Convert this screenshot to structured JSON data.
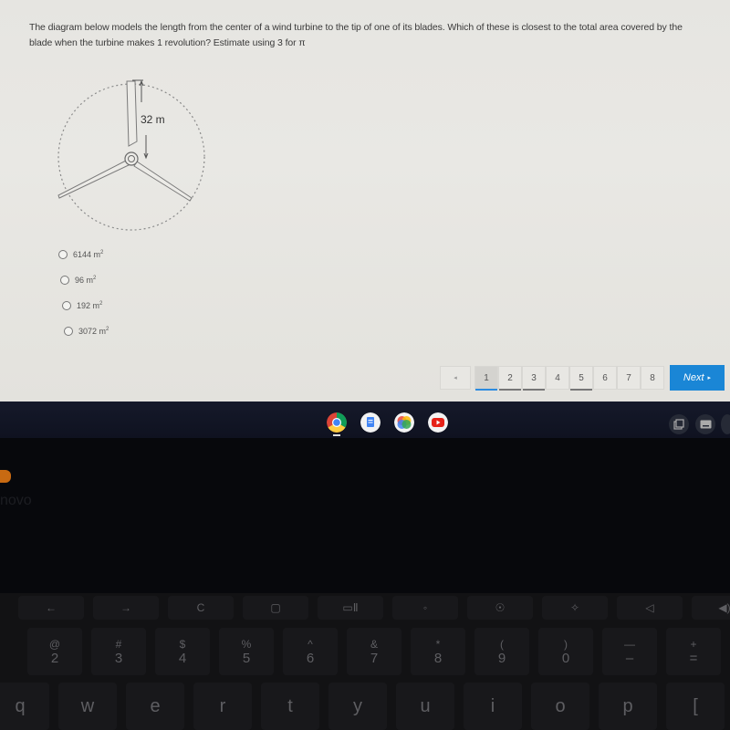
{
  "question": {
    "text": "The diagram below models the length from the center of a wind turbine to the tip of one of its blades.  Which of these is closest to the total area covered by the blade when the turbine makes 1 revolution?  Estimate using 3 for π"
  },
  "diagram": {
    "label": "32 m"
  },
  "choices": [
    {
      "value": "6144",
      "unit": "m",
      "exp": "2"
    },
    {
      "value": "96",
      "unit": "m",
      "exp": "2"
    },
    {
      "value": "192",
      "unit": "m",
      "exp": "2"
    },
    {
      "value": "3072",
      "unit": "m",
      "exp": "2"
    }
  ],
  "pager": {
    "prev_icon": "◂",
    "pages": [
      "1",
      "2",
      "3",
      "4",
      "5",
      "6",
      "7",
      "8"
    ],
    "current": "1",
    "answered": [
      "2",
      "3",
      "5"
    ],
    "next_label": "Next",
    "next_icon": "▸"
  },
  "shelf": {
    "apps": [
      {
        "name": "chrome",
        "active": true
      },
      {
        "name": "docs"
      },
      {
        "name": "photos"
      },
      {
        "name": "youtube"
      }
    ]
  },
  "laptop": {
    "brand": "novo"
  },
  "keyboard": {
    "function_row": [
      "←",
      "→",
      "C",
      "▢",
      "▭Ⅱ",
      "◦",
      "☉",
      "✧",
      "◁",
      "◀)"
    ],
    "number_row": [
      {
        "top": "@",
        "bot": "2"
      },
      {
        "top": "#",
        "bot": "3"
      },
      {
        "top": "$",
        "bot": "4"
      },
      {
        "top": "%",
        "bot": "5"
      },
      {
        "top": "^",
        "bot": "6"
      },
      {
        "top": "&",
        "bot": "7"
      },
      {
        "top": "*",
        "bot": "8"
      },
      {
        "top": "(",
        "bot": "9"
      },
      {
        "top": ")",
        "bot": "0"
      },
      {
        "top": "—",
        "bot": "–"
      },
      {
        "top": "+",
        "bot": "="
      }
    ],
    "letter_row": [
      "q",
      "w",
      "e",
      "r",
      "t",
      "y",
      "u",
      "i",
      "o",
      "p",
      "["
    ]
  },
  "colors": {
    "accent": "#1a86d6",
    "page_bg": "#e6e5e1",
    "shelf_bg": "#15192a"
  }
}
